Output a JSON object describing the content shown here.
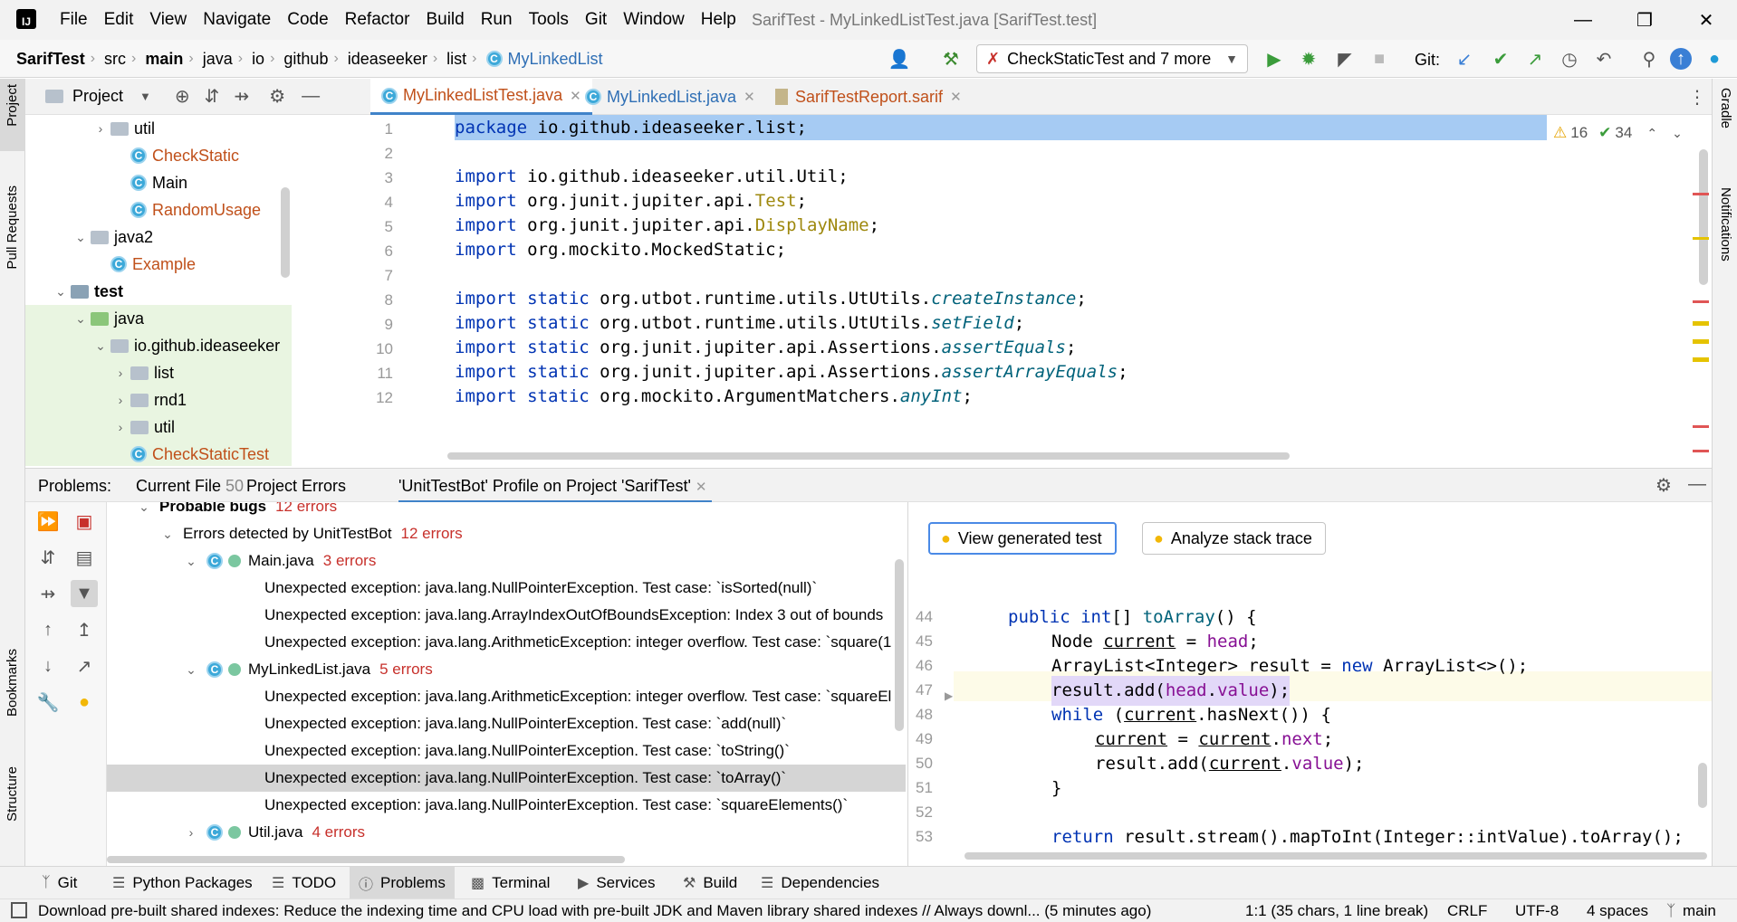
{
  "titlebar": {
    "logo": "IJ",
    "menu": [
      "File",
      "Edit",
      "View",
      "Navigate",
      "Code",
      "Refactor",
      "Build",
      "Run",
      "Tools",
      "Git",
      "Window",
      "Help"
    ],
    "window_title": "SarifTest - MyLinkedListTest.java [SarifTest.test]"
  },
  "navbar": {
    "breadcrumb": [
      "SarifTest",
      "src",
      "main",
      "java",
      "io",
      "github",
      "ideaseeker",
      "list",
      "MyLinkedList"
    ],
    "run_config": "CheckStaticTest and 7 more",
    "git_label": "Git:"
  },
  "left_strip": {
    "project": "Project",
    "pull_requests": "Pull Requests",
    "bookmarks": "Bookmarks",
    "structure": "Structure"
  },
  "right_strip": {
    "gradle": "Gradle",
    "notifications": "Notifications"
  },
  "project_panel": {
    "title": "Project",
    "tree": [
      {
        "label": "util",
        "kind": "folder",
        "indent": 2,
        "expand": "collapsed"
      },
      {
        "label": "CheckStatic",
        "kind": "class",
        "indent": 3,
        "red": true
      },
      {
        "label": "Main",
        "kind": "class",
        "indent": 3,
        "red": false
      },
      {
        "label": "RandomUsage",
        "kind": "class",
        "indent": 3,
        "red": true
      },
      {
        "label": "java2",
        "kind": "folder",
        "indent": 1,
        "expand": "expanded"
      },
      {
        "label": "Example",
        "kind": "class",
        "indent": 2,
        "red": true
      },
      {
        "label": "test",
        "kind": "testfolder",
        "indent": 0,
        "expand": "expanded",
        "bold": true
      },
      {
        "label": "java",
        "kind": "greenfolder",
        "indent": 1,
        "expand": "expanded",
        "hl": true
      },
      {
        "label": "io.github.ideaseeker",
        "kind": "folder",
        "indent": 2,
        "expand": "expanded",
        "hl": true
      },
      {
        "label": "list",
        "kind": "folder",
        "indent": 3,
        "expand": "collapsed",
        "hl": true
      },
      {
        "label": "rnd1",
        "kind": "folder",
        "indent": 3,
        "expand": "collapsed",
        "hl": true
      },
      {
        "label": "util",
        "kind": "folder",
        "indent": 3,
        "expand": "collapsed",
        "hl": true
      },
      {
        "label": "CheckStaticTest",
        "kind": "class",
        "indent": 3,
        "red": true,
        "hl": true
      }
    ]
  },
  "editor": {
    "tabs": [
      {
        "label": "MyLinkedListTest.java",
        "red": true,
        "active": true
      },
      {
        "label": "MyLinkedList.java",
        "red": false,
        "active": false
      },
      {
        "label": "SarifTestReport.sarif",
        "red": true,
        "active": false
      }
    ],
    "warnings": "16",
    "typos": "34",
    "line_numbers": [
      "1",
      "2",
      "3",
      "4",
      "5",
      "6",
      "7",
      "8",
      "9",
      "10",
      "11",
      "12"
    ]
  },
  "problems": {
    "tabs": [
      "Problems:",
      "Current File",
      "Project Errors",
      "'UnitTestBot' Profile on Project 'SarifTest'"
    ],
    "current_file_count": "50",
    "tree": [
      {
        "text": "Probable bugs",
        "count": "12 errors",
        "indent": 0,
        "bold": true,
        "chev": "v"
      },
      {
        "text": "Errors detected by UnitTestBot",
        "count": "12 errors",
        "indent": 1,
        "chev": "v"
      },
      {
        "text": "Main.java",
        "count": "3 errors",
        "indent": 2,
        "chev": "v",
        "icon": true
      },
      {
        "text": "Unexpected exception: java.lang.NullPointerException. Test case: `isSorted(null)`",
        "indent": 3
      },
      {
        "text": "Unexpected exception: java.lang.ArrayIndexOutOfBoundsException: Index 3 out of bounds",
        "indent": 3
      },
      {
        "text": "Unexpected exception: java.lang.ArithmeticException: integer overflow. Test case: `square(1",
        "indent": 3
      },
      {
        "text": "MyLinkedList.java",
        "count": "5 errors",
        "indent": 2,
        "chev": "v",
        "icon": true
      },
      {
        "text": "Unexpected exception: java.lang.ArithmeticException: integer overflow. Test case: `squareEl",
        "indent": 3
      },
      {
        "text": "Unexpected exception: java.lang.NullPointerException. Test case: `add(null)`",
        "indent": 3
      },
      {
        "text": "Unexpected exception: java.lang.NullPointerException. Test case: `toString()`",
        "indent": 3
      },
      {
        "text": "Unexpected exception: java.lang.NullPointerException. Test case: `toArray()`",
        "indent": 3,
        "selected": true
      },
      {
        "text": "Unexpected exception: java.lang.NullPointerException. Test case: `squareElements()`",
        "indent": 3
      },
      {
        "text": "Util.java",
        "count": "4 errors",
        "indent": 2,
        "chev": ">",
        "icon": true
      }
    ],
    "buttons": {
      "view_test": "View generated test",
      "analyze": "Analyze stack trace"
    },
    "detail_line_numbers": [
      "44",
      "45",
      "46",
      "47",
      "48",
      "49",
      "50",
      "51",
      "52",
      "53"
    ]
  },
  "bottombar": {
    "tools": [
      "Git",
      "Python Packages",
      "TODO",
      "Problems",
      "Terminal",
      "Services",
      "Build",
      "Dependencies"
    ]
  },
  "statusbar": {
    "message": "Download pre-built shared indexes: Reduce the indexing time and CPU load with pre-built JDK and Maven library shared indexes // Always downl... (5 minutes ago)",
    "position": "1:1 (35 chars, 1 line break)",
    "line_sep": "CRLF",
    "encoding": "UTF-8",
    "indent": "4 spaces",
    "branch": "main"
  }
}
